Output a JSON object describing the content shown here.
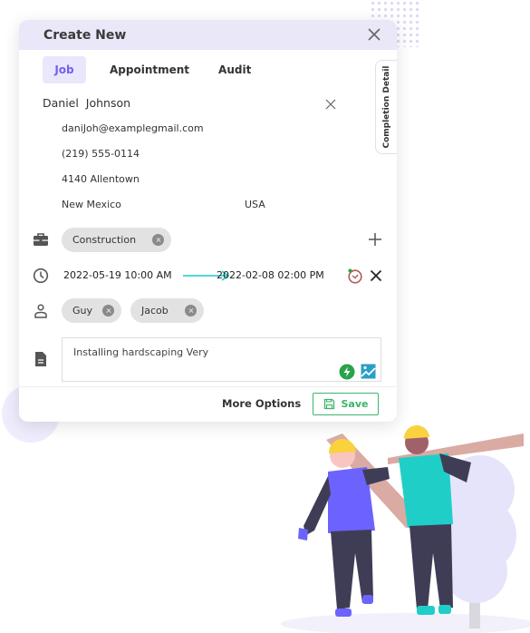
{
  "dialog": {
    "title": "Create New",
    "tabs": [
      {
        "label": "Job",
        "active": true
      },
      {
        "label": "Appointment",
        "active": false
      },
      {
        "label": "Audit",
        "active": false
      }
    ],
    "side_tab_label": "Completion Detail"
  },
  "contact": {
    "name": "Daniel  Johnson",
    "email": "daniJoh@examplegmail.com",
    "phone": "(219) 555-0114",
    "address": "4140 Allentown",
    "state": "New Mexico",
    "country": "USA"
  },
  "category": {
    "chips": [
      "Construction"
    ]
  },
  "schedule": {
    "start": "2022-05-19 10:00 AM",
    "end": "2022-02-08 02:00 PM"
  },
  "assignees": {
    "chips": [
      "Guy",
      "Jacob"
    ]
  },
  "notes": {
    "value": "Installing hardscaping  Very"
  },
  "footer": {
    "more_options_label": "More Options",
    "save_label": "Save"
  },
  "colors": {
    "accent": "#6f63e8",
    "header_bg": "#e9e7f8",
    "save_green": "#3bb56a",
    "arrow_teal": "#1fc7cf",
    "timer_red": "#b25a5a"
  }
}
